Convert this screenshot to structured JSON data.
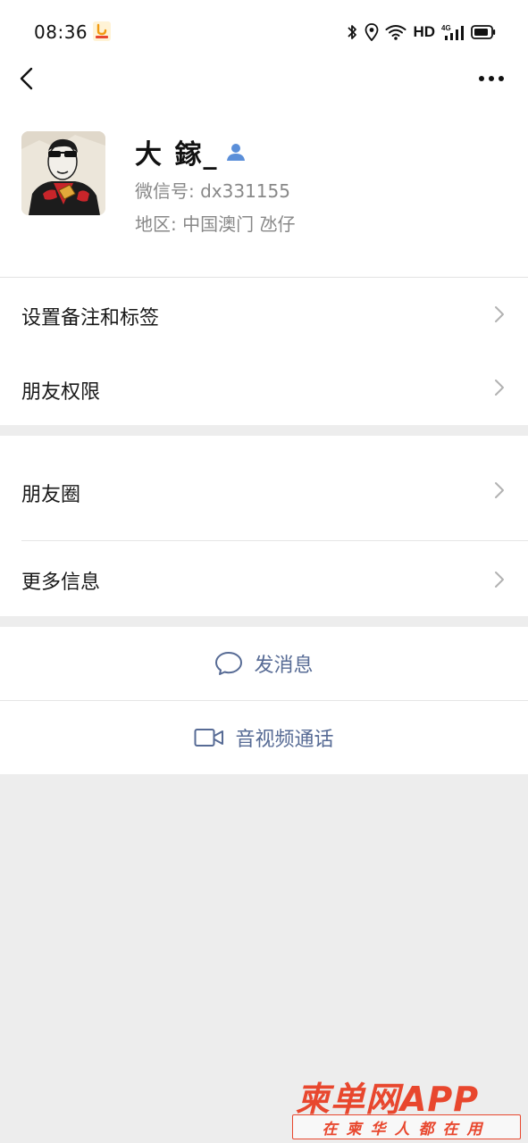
{
  "status_bar": {
    "time": "08:36",
    "network_label": "HD",
    "signal_label": "4G",
    "icons": [
      "app-notification-icon",
      "bluetooth-icon",
      "location-icon",
      "wifi-icon",
      "cellular-signal-icon",
      "battery-icon"
    ]
  },
  "nav": {
    "icons": [
      "back-arrow-icon",
      "more-options-icon"
    ]
  },
  "profile": {
    "nickname": "大  鎵_",
    "wechat_id": "微信号: dx331155",
    "region": "地区: 中国澳门  氹仔",
    "badge_icon": "contact-person-icon",
    "badge_color": "#5b8fd9"
  },
  "menu_group_1": {
    "items": [
      {
        "label": "设置备注和标签"
      },
      {
        "label": "朋友权限"
      }
    ]
  },
  "menu_group_2": {
    "items": [
      {
        "label": "朋友圈"
      },
      {
        "label": "更多信息"
      }
    ]
  },
  "actions": {
    "send_message": {
      "label": "发消息",
      "icon": "chat-bubble-icon"
    },
    "av_call": {
      "label": "音视频通话",
      "icon": "video-camera-icon"
    }
  },
  "watermark": {
    "title": "柬单网APP",
    "subtitle": "在柬华人都在用"
  },
  "colors": {
    "background": "#ededed",
    "surface": "#ffffff",
    "link_blue": "#576b95",
    "secondary_text": "#888888",
    "watermark_red": "#e8472e"
  }
}
